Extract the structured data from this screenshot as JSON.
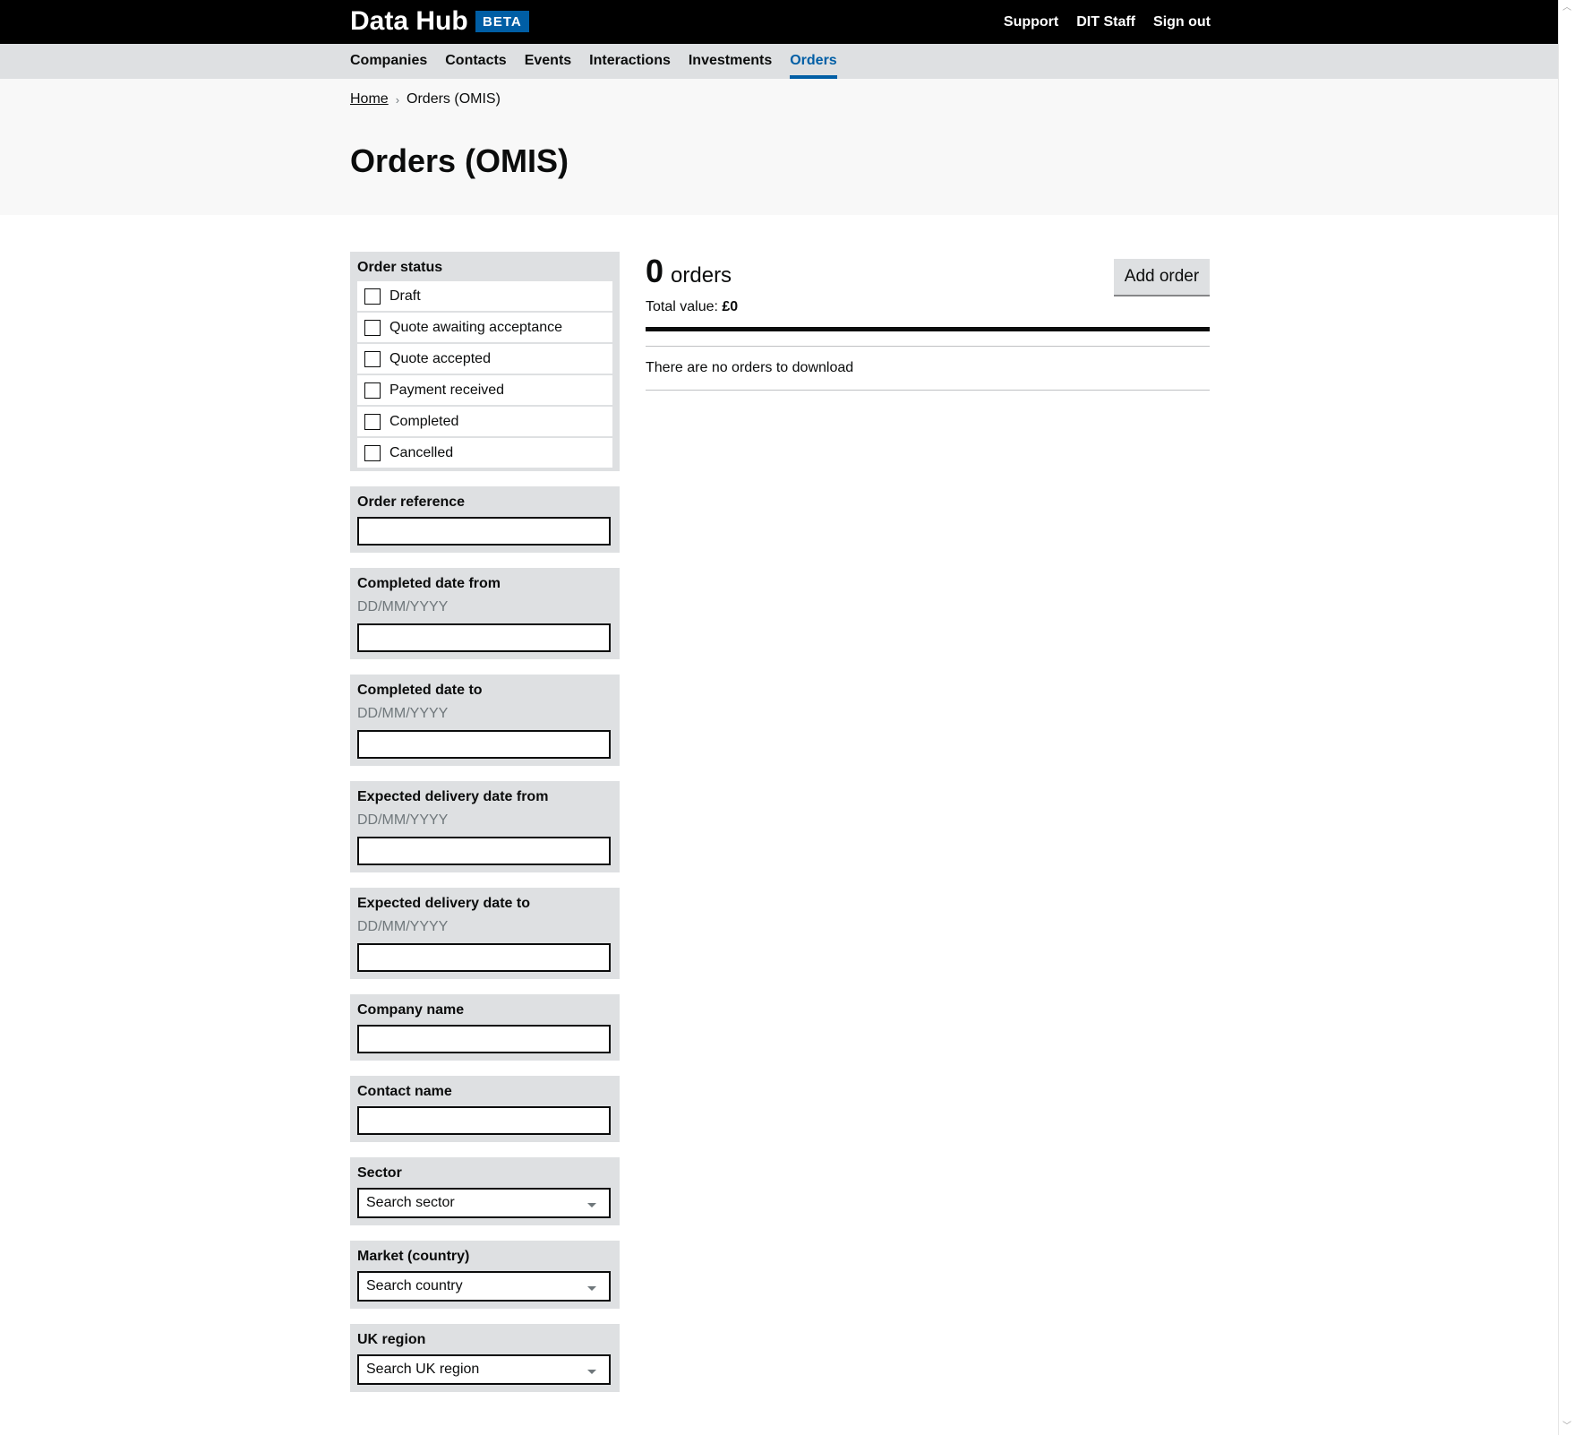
{
  "header": {
    "logo": "Data Hub",
    "badge": "BETA",
    "links": [
      "Support",
      "DIT Staff",
      "Sign out"
    ]
  },
  "nav": {
    "items": [
      "Companies",
      "Contacts",
      "Events",
      "Interactions",
      "Investments",
      "Orders"
    ],
    "active": "Orders"
  },
  "breadcrumb": {
    "home": "Home",
    "separator": "›",
    "current": "Orders (OMIS)"
  },
  "page_title": "Orders (OMIS)",
  "filters": {
    "order_status": {
      "label": "Order status",
      "options": [
        "Draft",
        "Quote awaiting acceptance",
        "Quote accepted",
        "Payment received",
        "Completed",
        "Cancelled"
      ]
    },
    "order_reference": {
      "label": "Order reference",
      "value": ""
    },
    "completed_date_from": {
      "label": "Completed date from",
      "hint": "DD/MM/YYYY",
      "value": ""
    },
    "completed_date_to": {
      "label": "Completed date to",
      "hint": "DD/MM/YYYY",
      "value": ""
    },
    "expected_delivery_from": {
      "label": "Expected delivery date from",
      "hint": "DD/MM/YYYY",
      "value": ""
    },
    "expected_delivery_to": {
      "label": "Expected delivery date to",
      "hint": "DD/MM/YYYY",
      "value": ""
    },
    "company_name": {
      "label": "Company name",
      "value": ""
    },
    "contact_name": {
      "label": "Contact name",
      "value": ""
    },
    "sector": {
      "label": "Sector",
      "placeholder": "Search sector"
    },
    "market": {
      "label": "Market (country)",
      "placeholder": "Search country"
    },
    "uk_region": {
      "label": "UK region",
      "placeholder": "Search UK region"
    }
  },
  "results": {
    "count": "0",
    "count_label": "orders",
    "total_label": "Total value:",
    "total_value": "£0",
    "add_button": "Add order",
    "empty_message": "There are no orders to download"
  },
  "colors": {
    "brand_blue": "#005ea5",
    "nav_bg": "#dee0e2",
    "topbar_bg": "#000000"
  }
}
